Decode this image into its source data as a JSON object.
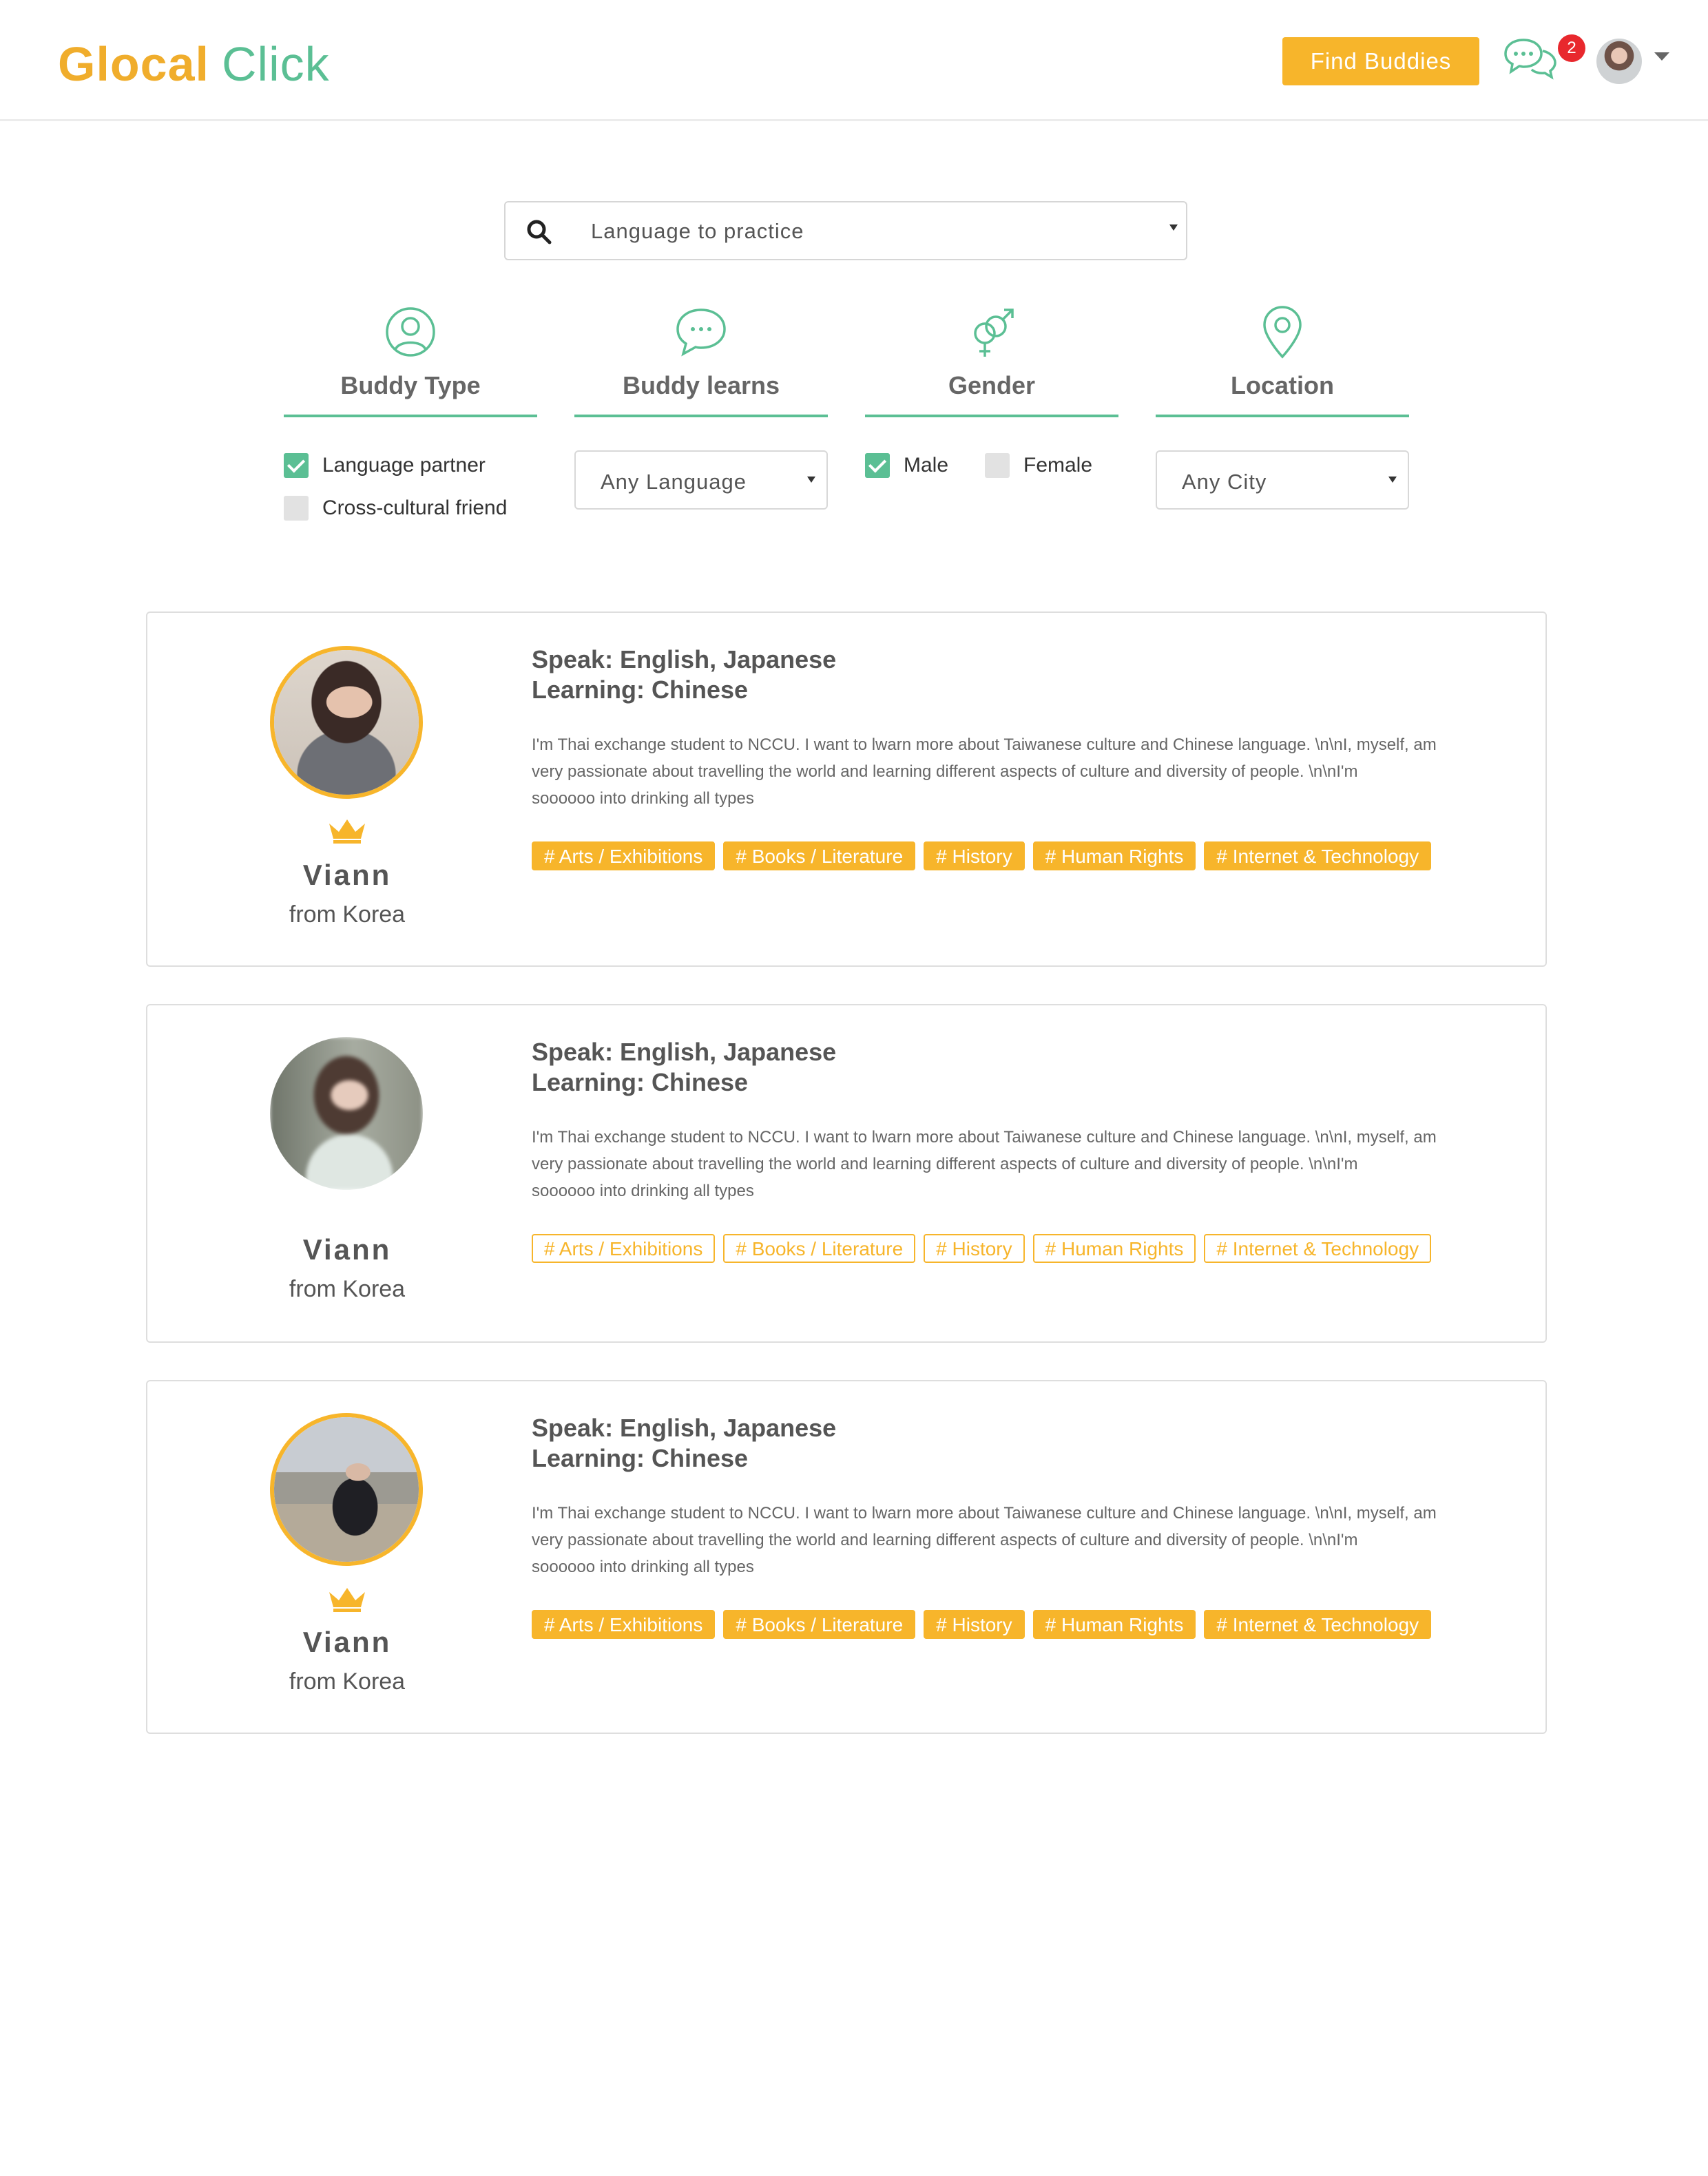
{
  "header": {
    "logo_part1": "Glocal",
    "logo_part2": "Click",
    "find_label": "Find Buddies",
    "notifications": "2",
    "brand_color": "#f7b52b",
    "accent_color": "#5bbf94"
  },
  "search": {
    "placeholder": "Language to practice"
  },
  "filters": {
    "buddy_type": {
      "title": "Buddy Type",
      "options": [
        {
          "label": "Language partner",
          "checked": true
        },
        {
          "label": "Cross-cultural friend",
          "checked": false
        }
      ]
    },
    "buddy_learns": {
      "title": "Buddy learns",
      "value": "Any Language"
    },
    "gender": {
      "title": "Gender",
      "options": [
        {
          "label": "Male",
          "checked": true
        },
        {
          "label": "Female",
          "checked": false
        }
      ]
    },
    "location": {
      "title": "Location",
      "value": "Any City"
    }
  },
  "buddies": [
    {
      "name": "Viann",
      "from": "from Korea",
      "premium": true,
      "speak": "Speak: English, Japanese",
      "learn": "Learning: Chinese",
      "desc": [
        "I'm Thai exchange student to NCCU. I want to lwarn more about Taiwanese culture and Chinese language. \\n\\nI, myself, am",
        "very passionate about travelling the world and learning different aspects of culture and diversity of people. \\n\\nI'm",
        "soooooo into drinking all types"
      ],
      "tags": [
        "# Arts / Exhibitions",
        "# Books / Literature",
        "# History",
        "# Human Rights",
        "# Internet & Technology"
      ]
    },
    {
      "name": "Viann",
      "from": "from Korea",
      "premium": false,
      "speak": "Speak: English, Japanese",
      "learn": "Learning: Chinese",
      "desc": [
        "I'm Thai exchange student to NCCU. I want to lwarn more about Taiwanese culture and Chinese language. \\n\\nI, myself, am",
        "very passionate about travelling the world and learning different aspects of culture and diversity of people. \\n\\nI'm",
        "soooooo into drinking all types"
      ],
      "tags": [
        "# Arts / Exhibitions",
        "# Books / Literature",
        "# History",
        "# Human Rights",
        "# Internet & Technology"
      ]
    },
    {
      "name": "Viann",
      "from": "from Korea",
      "premium": true,
      "speak": "Speak: English, Japanese",
      "learn": "Learning: Chinese",
      "desc": [
        "I'm Thai exchange student to NCCU. I want to lwarn more about Taiwanese culture and Chinese language. \\n\\nI, myself, am",
        "very passionate about travelling the world and learning different aspects of culture and diversity of people. \\n\\nI'm",
        "soooooo into drinking all types"
      ],
      "tags": [
        "# Arts / Exhibitions",
        "# Books / Literature",
        "# History",
        "# Human Rights",
        "# Internet & Technology"
      ]
    }
  ]
}
